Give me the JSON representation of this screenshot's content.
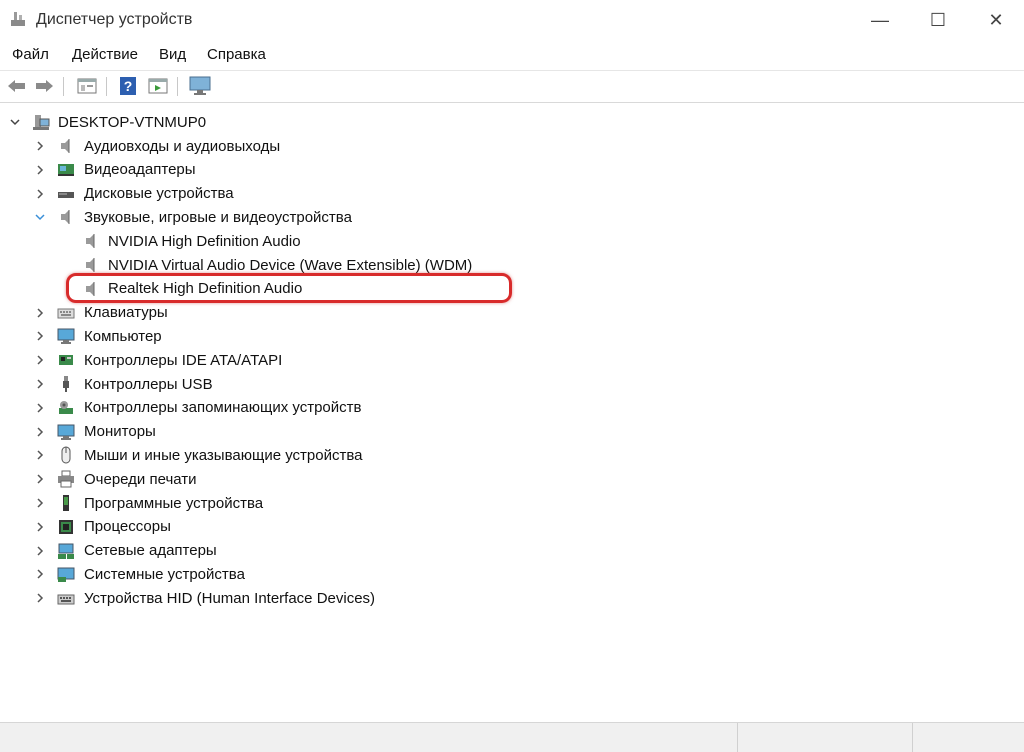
{
  "window": {
    "title": "Диспетчер устройств",
    "minimize": "—",
    "maximize": "☐",
    "close": "✕"
  },
  "menu": [
    "Файл",
    "Действие",
    "Вид",
    "Справка"
  ],
  "toolbar": {
    "icons": [
      "back-arrow-icon",
      "forward-arrow-icon",
      "properties-icon",
      "help-icon",
      "view-icon",
      "monitor-icon"
    ]
  },
  "tree": {
    "root": "DESKTOP-VTNMUP0",
    "categories": [
      {
        "label": "Аудиовходы и аудиовыходы",
        "icon": "speaker-icon"
      },
      {
        "label": "Видеоадаптеры",
        "icon": "display-adapter-icon"
      },
      {
        "label": "Дисковые устройства",
        "icon": "disk-icon"
      },
      {
        "label": "Звуковые, игровые и видеоустройства",
        "icon": "speaker-icon",
        "expanded": true,
        "children": [
          "NVIDIA High Definition Audio",
          "NVIDIA Virtual Audio Device (Wave Extensible) (WDM)",
          "Realtek High Definition Audio"
        ]
      },
      {
        "label": "Клавиатуры",
        "icon": "keyboard-icon"
      },
      {
        "label": "Компьютер",
        "icon": "computer-icon"
      },
      {
        "label": "Контроллеры IDE ATA/ATAPI",
        "icon": "ide-controller-icon"
      },
      {
        "label": "Контроллеры USB",
        "icon": "usb-icon"
      },
      {
        "label": "Контроллеры запоминающих устройств",
        "icon": "storage-controller-icon"
      },
      {
        "label": "Мониторы",
        "icon": "monitor-icon"
      },
      {
        "label": "Мыши и иные указывающие устройства",
        "icon": "mouse-icon"
      },
      {
        "label": "Очереди печати",
        "icon": "printer-icon"
      },
      {
        "label": "Программные устройства",
        "icon": "software-device-icon"
      },
      {
        "label": "Процессоры",
        "icon": "processor-icon"
      },
      {
        "label": "Сетевые адаптеры",
        "icon": "network-adapter-icon"
      },
      {
        "label": "Системные устройства",
        "icon": "system-device-icon"
      },
      {
        "label": "Устройства HID (Human Interface Devices)",
        "icon": "hid-icon"
      }
    ]
  },
  "colors": {
    "highlight_border": "#d82b2b",
    "status_bg": "#f0f0f0"
  }
}
